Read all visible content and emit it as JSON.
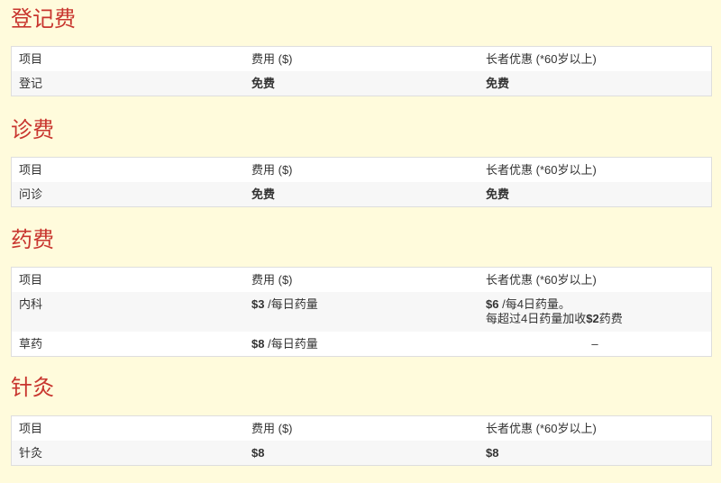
{
  "registration": {
    "title": "登记费",
    "header": {
      "item": "项目",
      "fee": "费用 ($)",
      "senior": "长者优惠 (*60岁以上)"
    },
    "rows": [
      {
        "item": "登记",
        "fee": "免费",
        "senior": "免费"
      }
    ]
  },
  "consultation": {
    "title": "诊费",
    "header": {
      "item": "项目",
      "fee": "费用 ($)",
      "senior": "长者优惠 (*60岁以上)"
    },
    "rows": [
      {
        "item": "问诊",
        "fee": "免费",
        "senior": "免费"
      }
    ]
  },
  "medicine": {
    "title": "药费",
    "header": {
      "item": "项目",
      "fee": "费用 ($)",
      "senior": "长者优惠 (*60岁以上)"
    },
    "rows": [
      {
        "item": "内科",
        "fee_amount": "$3",
        "fee_unit": " /每日药量",
        "senior_amount": "$6",
        "senior_unit": " /每4日药量。",
        "senior_note_prefix": "每超过4日药量加收",
        "senior_note_amount": "$2",
        "senior_note_suffix": "药费"
      },
      {
        "item": "草药",
        "fee_amount": "$8",
        "fee_unit": " /每日药量",
        "senior": "–"
      }
    ]
  },
  "acupuncture": {
    "title": "针灸",
    "header": {
      "item": "项目",
      "fee": "费用 ($)",
      "senior": "长者优惠 (*60岁以上)"
    },
    "rows": [
      {
        "item": "针灸",
        "fee": "$8",
        "senior": "$8"
      }
    ]
  },
  "colors": {
    "background": "#fffbdc",
    "title": "#c8352e",
    "table_border": "#dedede",
    "row_alt": "#f7f7f7"
  }
}
